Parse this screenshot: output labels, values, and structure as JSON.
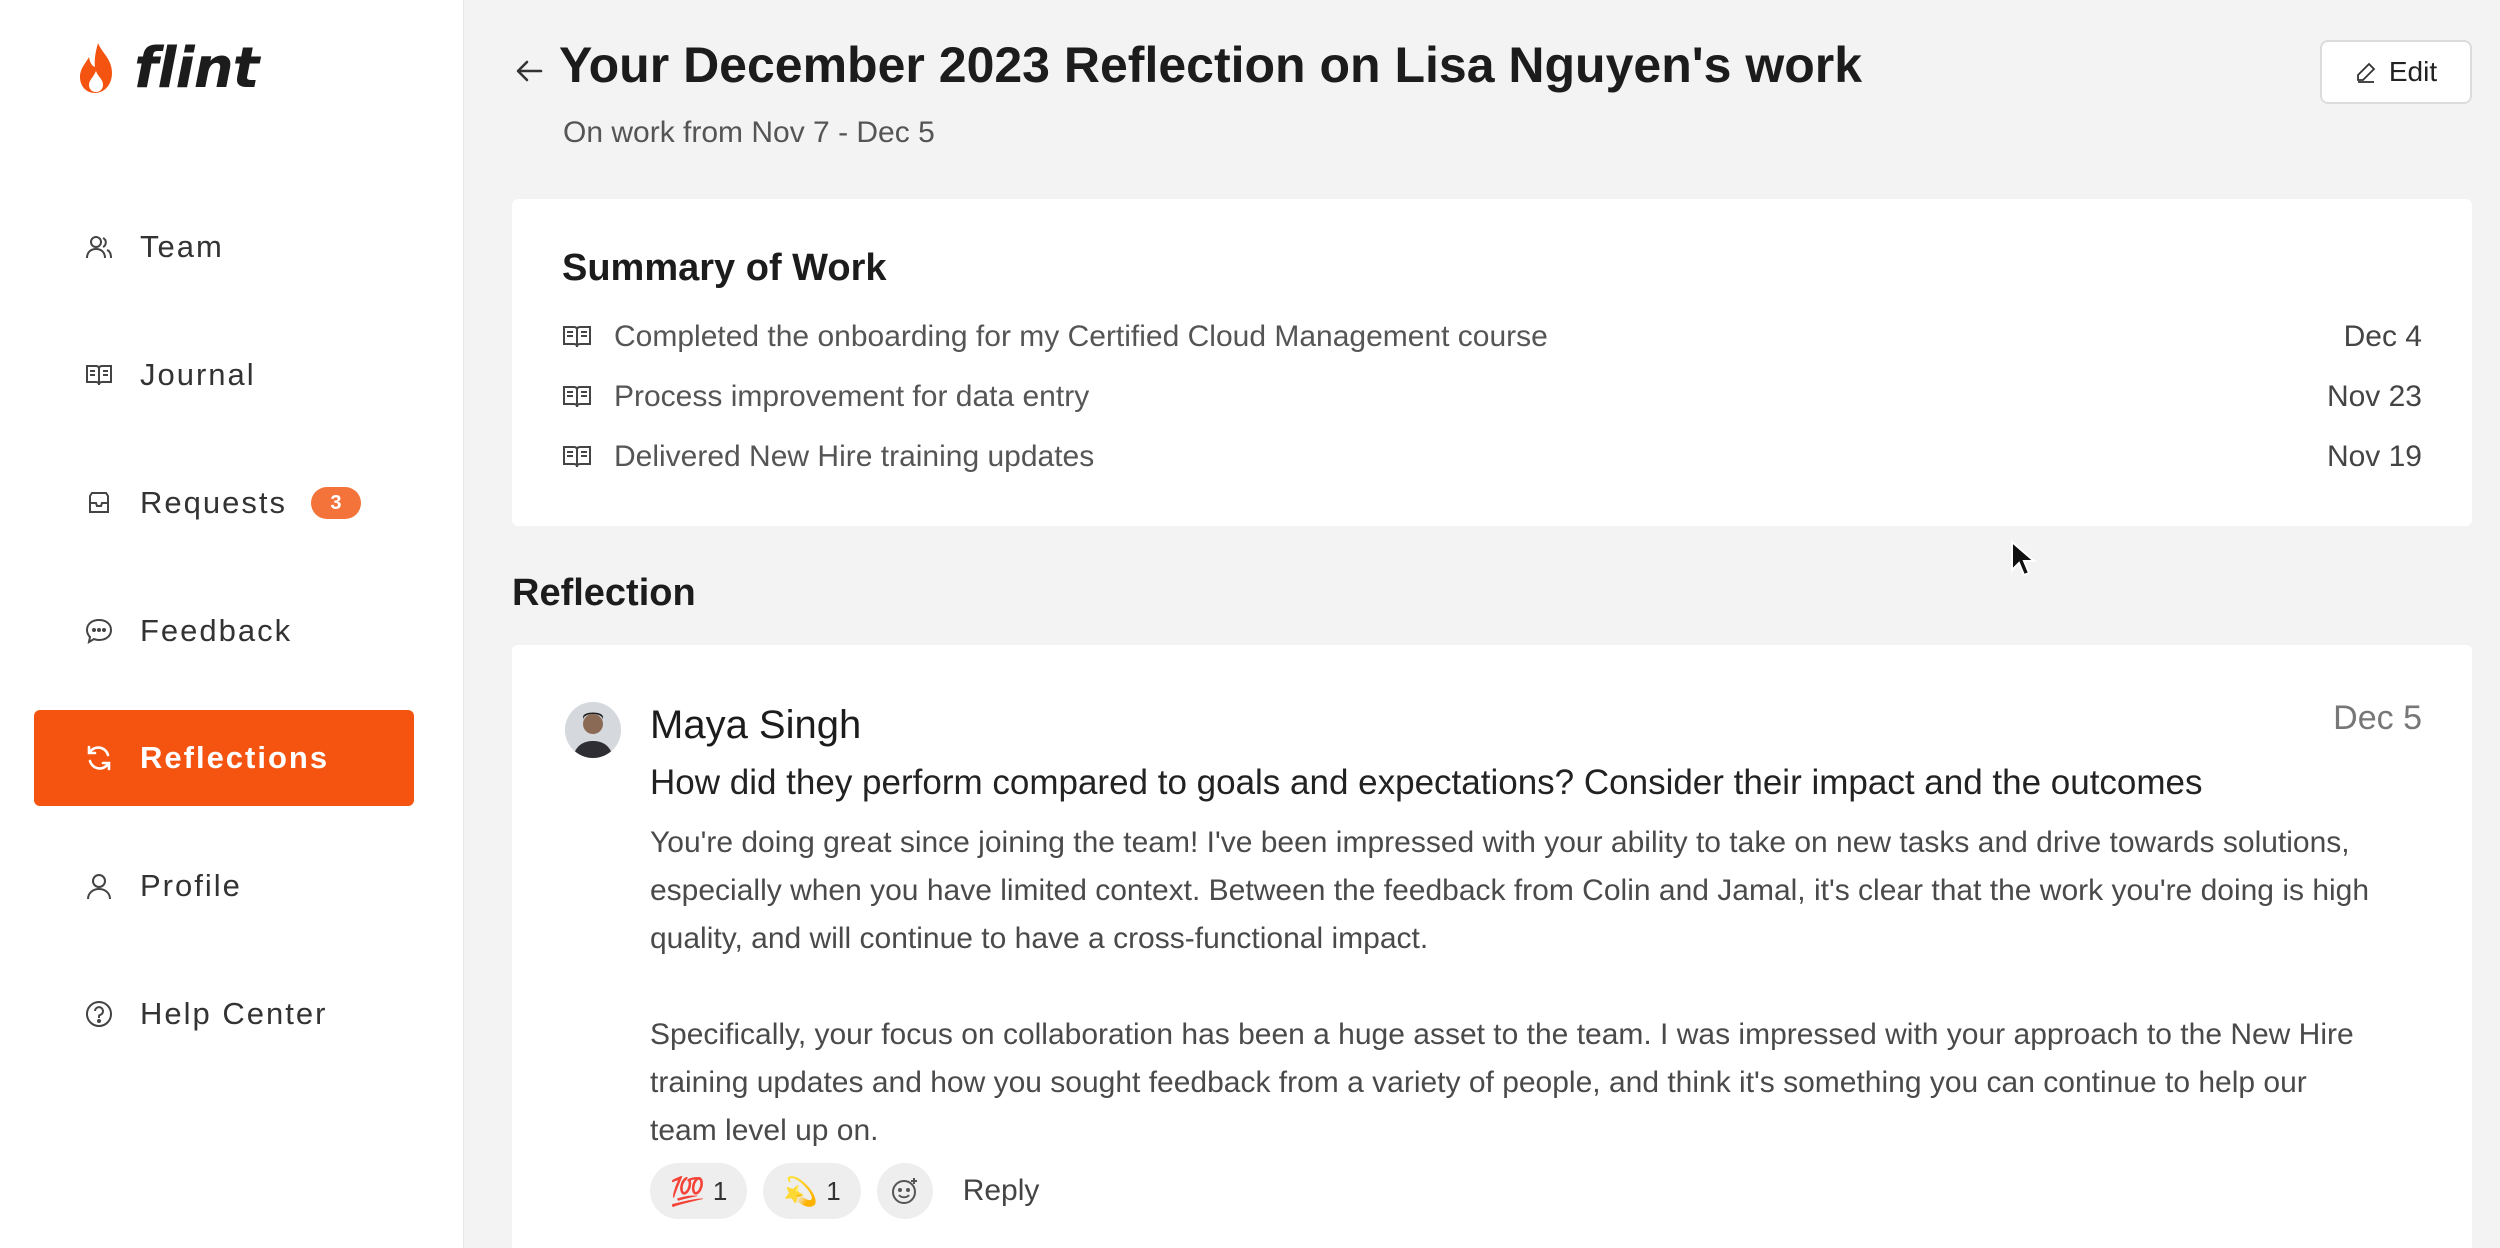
{
  "app": {
    "name": "flint"
  },
  "sidebar": {
    "items": [
      {
        "label": "Team",
        "icon": "team-icon"
      },
      {
        "label": "Journal",
        "icon": "journal-icon"
      },
      {
        "label": "Requests",
        "icon": "inbox-icon",
        "badge": "3"
      },
      {
        "label": "Feedback",
        "icon": "chat-icon"
      },
      {
        "label": "Reflections",
        "icon": "refresh-icon",
        "active": true
      },
      {
        "label": "Profile",
        "icon": "user-icon"
      },
      {
        "label": "Help Center",
        "icon": "help-icon"
      }
    ]
  },
  "header": {
    "title": "Your December 2023 Reflection on Lisa Nguyen's work",
    "subtitle": "On work from Nov 7 - Dec 5",
    "edit_label": "Edit"
  },
  "summary": {
    "title": "Summary of Work",
    "items": [
      {
        "text": "Completed the onboarding for my Certified Cloud Management course",
        "date": "Dec 4"
      },
      {
        "text": "Process improvement for data entry",
        "date": "Nov 23"
      },
      {
        "text": "Delivered New Hire training updates",
        "date": "Nov 19"
      }
    ]
  },
  "reflection": {
    "section_title": "Reflection",
    "author": "Maya Singh",
    "date": "Dec 5",
    "question": "How did they perform compared to goals and expectations? Consider their impact and the outcomes",
    "paragraphs": [
      "You're doing great since joining the team! I've been impressed with your ability to take on new tasks and drive towards solutions, especially when you have limited context. Between the feedback from Colin and Jamal, it's clear that the work you're doing is high quality, and will continue to have a cross-functional impact.",
      "Specifically, your focus on collaboration has been a huge asset to the team. I was impressed with your approach to the New Hire training updates and how you sought feedback from a variety of people, and think it's something you can continue to help our team level up on."
    ],
    "reactions": [
      {
        "emoji": "💯",
        "count": "1"
      },
      {
        "emoji": "💫",
        "count": "1"
      }
    ],
    "reply_label": "Reply"
  },
  "colors": {
    "accent": "#f45410",
    "badge": "#f4733a"
  }
}
